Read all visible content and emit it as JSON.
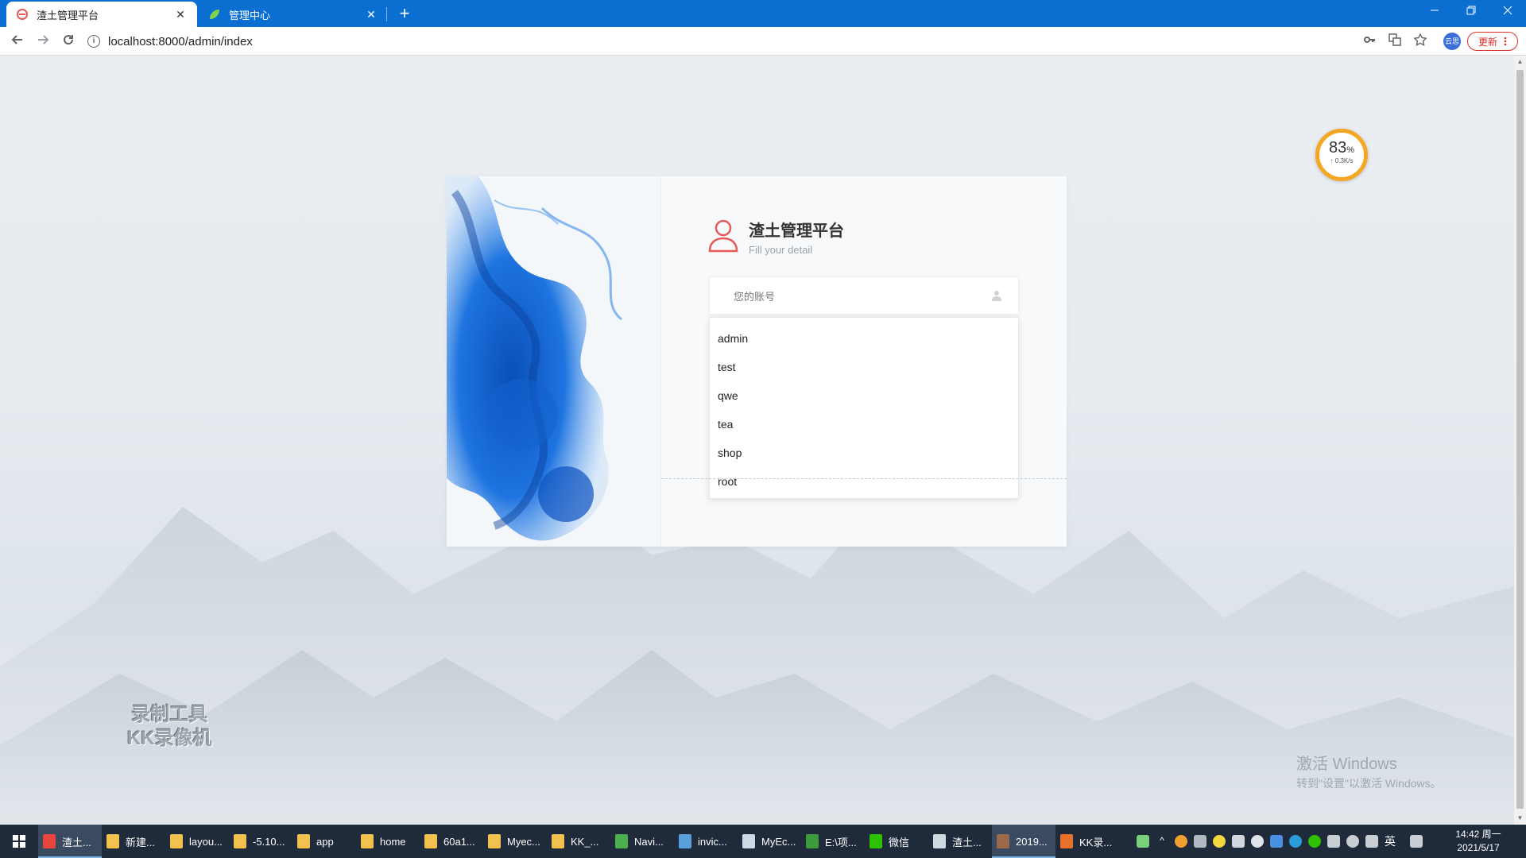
{
  "browser": {
    "tabs": [
      {
        "title": "渣土管理平台",
        "active": true
      },
      {
        "title": "管理中心",
        "active": false
      }
    ],
    "close_glyph": "✕",
    "new_tab_glyph": "+",
    "url": "localhost:8000/admin/index",
    "profile_label": "云思",
    "update_label": "更新",
    "colors": {
      "titlebar": "#0b6fd1",
      "update": "#d93025"
    }
  },
  "speed_widget": {
    "percent": "83",
    "percent_unit": "%",
    "rate": "↑ 0.3K/s"
  },
  "login": {
    "title": "渣土管理平台",
    "subtitle": "Fill your detail",
    "account_placeholder": "您的账号",
    "autocomplete_options": [
      "admin",
      "test",
      "qwe",
      "tea",
      "shop",
      "root"
    ],
    "brand_color": "#e85a5a"
  },
  "watermarks": {
    "recorder_line1": "录制工具",
    "recorder_line2": "KK录像机",
    "activate_title": "激活 Windows",
    "activate_sub": "转到\"设置\"以激活 Windows。"
  },
  "taskbar": {
    "items": [
      {
        "label": "渣土...",
        "icon": "chrome-icon",
        "color": "#e8453c",
        "active": true
      },
      {
        "label": "新建...",
        "icon": "folder-icon",
        "color": "#f2c14e",
        "active": false
      },
      {
        "label": "layou...",
        "icon": "folder-icon",
        "color": "#f2c14e",
        "active": false
      },
      {
        "label": "-5.10...",
        "icon": "folder-icon",
        "color": "#f2c14e",
        "active": false
      },
      {
        "label": "app",
        "icon": "folder-icon",
        "color": "#f2c14e",
        "active": false
      },
      {
        "label": "home",
        "icon": "folder-icon",
        "color": "#f2c14e",
        "active": false
      },
      {
        "label": "60a1...",
        "icon": "folder-icon",
        "color": "#f2c14e",
        "active": false
      },
      {
        "label": "Myec...",
        "icon": "folder-icon",
        "color": "#f2c14e",
        "active": false
      },
      {
        "label": "KK_...",
        "icon": "folder-icon",
        "color": "#f2c14e",
        "active": false
      },
      {
        "label": "Navi...",
        "icon": "navicat-icon",
        "color": "#4caf50",
        "active": false
      },
      {
        "label": "invic...",
        "icon": "window-icon",
        "color": "#5aa0d8",
        "active": false
      },
      {
        "label": "MyEc...",
        "icon": "feather-icon",
        "color": "#cfd8e3",
        "active": false
      },
      {
        "label": "E:\\项...",
        "icon": "editor-icon",
        "color": "#3d9b3d",
        "active": false
      },
      {
        "label": "微信",
        "icon": "wechat-icon",
        "color": "#2dc100",
        "active": false
      },
      {
        "label": "渣土...",
        "icon": "chat-icon",
        "color": "#d0d8e0",
        "active": false
      },
      {
        "label": "2019...",
        "icon": "app-icon",
        "color": "#9a6a4a",
        "active": true
      },
      {
        "label": "KK录...",
        "icon": "recorder-icon",
        "color": "#e8722c",
        "active": false
      }
    ],
    "tray_lang": "英",
    "clock_time": "14:42 周一",
    "clock_date": "2021/5/17"
  }
}
